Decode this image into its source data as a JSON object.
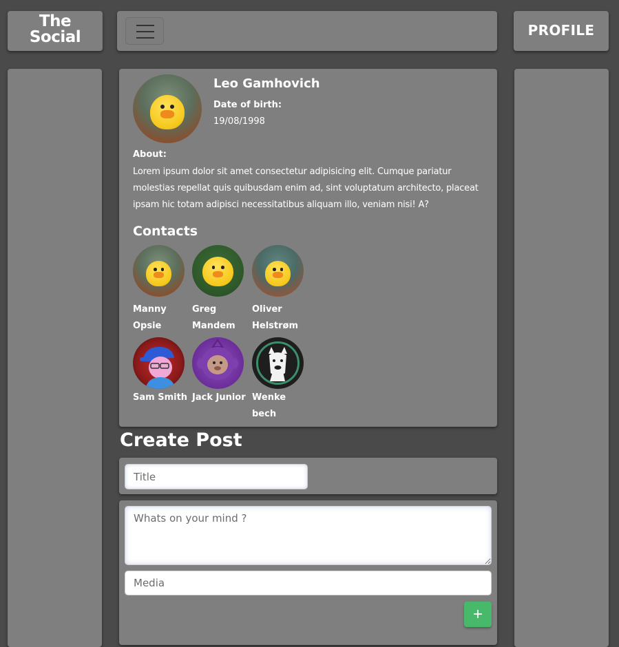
{
  "header": {
    "logo_line1": "The",
    "logo_line2": "Social",
    "profile_label": "PROFILE"
  },
  "profile": {
    "name": "Leo Gamhovich",
    "dob_label": "Date of birth:",
    "dob_value": "19/08/1998",
    "about_label": "About:",
    "about_text": "Lorem ipsum dolor sit amet consectetur adipisicing elit. Cumque pariatur molestias repellat quis quibusdam enim ad, sint voluptatum architecto, placeat ipsam hic totam adipisci necessitatibus aliquam illo, veniam nisi! A?"
  },
  "contacts": {
    "title": "Contacts",
    "items": [
      {
        "name": "Manny Opsie",
        "icon": "duck-avatar"
      },
      {
        "name": "Greg Mandem",
        "icon": "duck-avatar"
      },
      {
        "name": "Oliver Helstrøm",
        "icon": "duck-avatar"
      },
      {
        "name": "Sam Smith",
        "icon": "cartoon-avatar"
      },
      {
        "name": "Jack Junior",
        "icon": "teletubby-avatar"
      },
      {
        "name": "Wenke bech",
        "icon": "llama-avatar"
      }
    ]
  },
  "create_post": {
    "title": "Create Post",
    "title_placeholder": "Title",
    "body_placeholder": "Whats on your mind ?",
    "media_placeholder": "Media",
    "add_label": "+"
  },
  "colors": {
    "page_bg": "#4a4a4a",
    "panel_bg": "#7f7f7f",
    "accent_green": "#48b96b"
  }
}
